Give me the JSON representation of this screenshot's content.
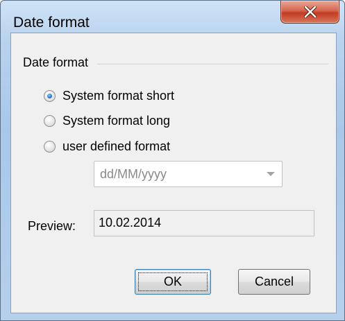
{
  "window": {
    "title": "Date format",
    "close_icon": "close-x-icon"
  },
  "group": {
    "label": "Date format"
  },
  "radios": [
    {
      "label": "System format short",
      "checked": true
    },
    {
      "label": "System format long",
      "checked": false
    },
    {
      "label": "user defined format",
      "checked": false
    }
  ],
  "format_combo": {
    "value": "dd/MM/yyyy",
    "enabled": false
  },
  "preview": {
    "label": "Preview:",
    "value": "10.02.2014"
  },
  "buttons": {
    "ok_label": "OK",
    "cancel_label": "Cancel"
  },
  "colors": {
    "close_button": "#c23b22",
    "radio_selected": "#2c73c8",
    "frame": "#a9c7e8"
  }
}
